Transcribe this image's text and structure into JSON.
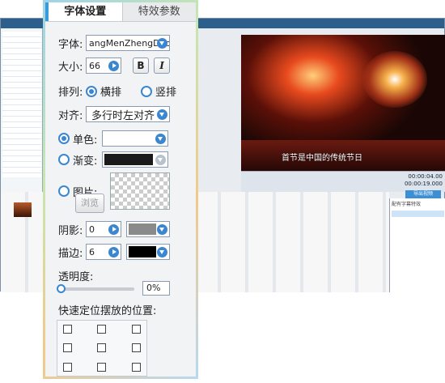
{
  "tabs": {
    "font_settings": "字体设置",
    "effect_params": "特效参数"
  },
  "font": {
    "label": "字体:",
    "value": "angMenZhengDao"
  },
  "size": {
    "label": "大小:",
    "value": "66",
    "bold": "B",
    "italic": "I"
  },
  "arrange": {
    "label": "排列:",
    "horizontal": "横排",
    "vertical": "竖排",
    "selected": "horizontal"
  },
  "align": {
    "label": "对齐:",
    "value": "多行时左对齐"
  },
  "solid": {
    "label": "单色:",
    "color": "#ffffff",
    "checked": true
  },
  "gradient": {
    "label": "渐变:",
    "color": "#1a1a1a",
    "checked": false
  },
  "image": {
    "label": "图片:",
    "checked": false,
    "browse": "浏览"
  },
  "shadow": {
    "label": "阴影:",
    "value": "0",
    "color": "#8a8a8a"
  },
  "stroke": {
    "label": "描边:",
    "value": "6",
    "color": "#000000"
  },
  "opacity": {
    "label": "透明度:",
    "value": "0%",
    "fraction": 0
  },
  "position": {
    "label": "快速定位摆放的位置:"
  },
  "background": {
    "subtitle": "首节是中国的传统节日",
    "time_current": "00:00:04.00",
    "time_total": "00:00:19.000",
    "export_label": "导出视频",
    "right_title": "配有字幕特效",
    "colors": {
      "accent": "#3a86d0",
      "titlebar": "#2d5f8c"
    }
  }
}
